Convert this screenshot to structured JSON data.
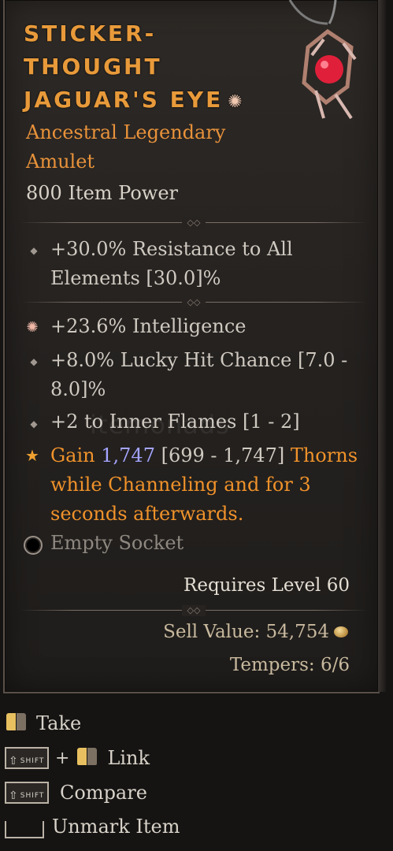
{
  "item": {
    "name_lines": [
      "STICKER-",
      "THOUGHT",
      "JAGUAR'S EYE"
    ],
    "legendary_mark": "✺",
    "rarity": "Ancestral Legendary",
    "type": "Amulet",
    "item_power": "800 Item Power",
    "implicit": {
      "line1": "+30.0% Resistance to All",
      "line2": "Elements [30.0]%"
    },
    "affixes": [
      {
        "line1": "+23.6% Intelligence",
        "line2": ""
      },
      {
        "line1": "+8.0% Lucky Hit Chance [7.0 -",
        "line2": "8.0]%"
      },
      {
        "line1": "+2 to Inner Flames [1 - 2]",
        "line2": ""
      }
    ],
    "unique_power": {
      "prefix": "Gain ",
      "value": "1,747",
      "range": " [699 - 1,747] ",
      "suffix_line1": "Thorns",
      "line2": "while Channeling and for 3",
      "line3": "seconds afterwards."
    },
    "socket": "Empty Socket",
    "requires_level": "Requires Level 60",
    "sell_value": "Sell Value: 54,754",
    "tempers": "Tempers: 6/6"
  },
  "watermark": "itemonads",
  "controls": {
    "take": "Take",
    "plus": "+",
    "link": "Link",
    "compare": "Compare",
    "unmark": "Unmark Item",
    "shift_key": "SHIFT"
  },
  "colors": {
    "title": "#e89a3a",
    "legendary": "#e8923a",
    "value_blue": "#a4a4ff",
    "text": "#cfc9c0"
  }
}
